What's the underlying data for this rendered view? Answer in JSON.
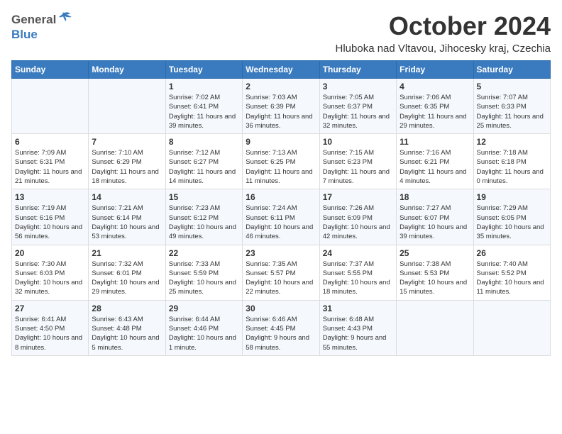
{
  "header": {
    "logo_general": "General",
    "logo_blue": "Blue",
    "month_title": "October 2024",
    "location": "Hluboka nad Vltavou, Jihocesky kraj, Czechia"
  },
  "calendar": {
    "days_of_week": [
      "Sunday",
      "Monday",
      "Tuesday",
      "Wednesday",
      "Thursday",
      "Friday",
      "Saturday"
    ],
    "weeks": [
      [
        {
          "day": "",
          "info": ""
        },
        {
          "day": "",
          "info": ""
        },
        {
          "day": "1",
          "info": "Sunrise: 7:02 AM\nSunset: 6:41 PM\nDaylight: 11 hours and 39 minutes."
        },
        {
          "day": "2",
          "info": "Sunrise: 7:03 AM\nSunset: 6:39 PM\nDaylight: 11 hours and 36 minutes."
        },
        {
          "day": "3",
          "info": "Sunrise: 7:05 AM\nSunset: 6:37 PM\nDaylight: 11 hours and 32 minutes."
        },
        {
          "day": "4",
          "info": "Sunrise: 7:06 AM\nSunset: 6:35 PM\nDaylight: 11 hours and 29 minutes."
        },
        {
          "day": "5",
          "info": "Sunrise: 7:07 AM\nSunset: 6:33 PM\nDaylight: 11 hours and 25 minutes."
        }
      ],
      [
        {
          "day": "6",
          "info": "Sunrise: 7:09 AM\nSunset: 6:31 PM\nDaylight: 11 hours and 21 minutes."
        },
        {
          "day": "7",
          "info": "Sunrise: 7:10 AM\nSunset: 6:29 PM\nDaylight: 11 hours and 18 minutes."
        },
        {
          "day": "8",
          "info": "Sunrise: 7:12 AM\nSunset: 6:27 PM\nDaylight: 11 hours and 14 minutes."
        },
        {
          "day": "9",
          "info": "Sunrise: 7:13 AM\nSunset: 6:25 PM\nDaylight: 11 hours and 11 minutes."
        },
        {
          "day": "10",
          "info": "Sunrise: 7:15 AM\nSunset: 6:23 PM\nDaylight: 11 hours and 7 minutes."
        },
        {
          "day": "11",
          "info": "Sunrise: 7:16 AM\nSunset: 6:21 PM\nDaylight: 11 hours and 4 minutes."
        },
        {
          "day": "12",
          "info": "Sunrise: 7:18 AM\nSunset: 6:18 PM\nDaylight: 11 hours and 0 minutes."
        }
      ],
      [
        {
          "day": "13",
          "info": "Sunrise: 7:19 AM\nSunset: 6:16 PM\nDaylight: 10 hours and 56 minutes."
        },
        {
          "day": "14",
          "info": "Sunrise: 7:21 AM\nSunset: 6:14 PM\nDaylight: 10 hours and 53 minutes."
        },
        {
          "day": "15",
          "info": "Sunrise: 7:23 AM\nSunset: 6:12 PM\nDaylight: 10 hours and 49 minutes."
        },
        {
          "day": "16",
          "info": "Sunrise: 7:24 AM\nSunset: 6:11 PM\nDaylight: 10 hours and 46 minutes."
        },
        {
          "day": "17",
          "info": "Sunrise: 7:26 AM\nSunset: 6:09 PM\nDaylight: 10 hours and 42 minutes."
        },
        {
          "day": "18",
          "info": "Sunrise: 7:27 AM\nSunset: 6:07 PM\nDaylight: 10 hours and 39 minutes."
        },
        {
          "day": "19",
          "info": "Sunrise: 7:29 AM\nSunset: 6:05 PM\nDaylight: 10 hours and 35 minutes."
        }
      ],
      [
        {
          "day": "20",
          "info": "Sunrise: 7:30 AM\nSunset: 6:03 PM\nDaylight: 10 hours and 32 minutes."
        },
        {
          "day": "21",
          "info": "Sunrise: 7:32 AM\nSunset: 6:01 PM\nDaylight: 10 hours and 29 minutes."
        },
        {
          "day": "22",
          "info": "Sunrise: 7:33 AM\nSunset: 5:59 PM\nDaylight: 10 hours and 25 minutes."
        },
        {
          "day": "23",
          "info": "Sunrise: 7:35 AM\nSunset: 5:57 PM\nDaylight: 10 hours and 22 minutes."
        },
        {
          "day": "24",
          "info": "Sunrise: 7:37 AM\nSunset: 5:55 PM\nDaylight: 10 hours and 18 minutes."
        },
        {
          "day": "25",
          "info": "Sunrise: 7:38 AM\nSunset: 5:53 PM\nDaylight: 10 hours and 15 minutes."
        },
        {
          "day": "26",
          "info": "Sunrise: 7:40 AM\nSunset: 5:52 PM\nDaylight: 10 hours and 11 minutes."
        }
      ],
      [
        {
          "day": "27",
          "info": "Sunrise: 6:41 AM\nSunset: 4:50 PM\nDaylight: 10 hours and 8 minutes."
        },
        {
          "day": "28",
          "info": "Sunrise: 6:43 AM\nSunset: 4:48 PM\nDaylight: 10 hours and 5 minutes."
        },
        {
          "day": "29",
          "info": "Sunrise: 6:44 AM\nSunset: 4:46 PM\nDaylight: 10 hours and 1 minute."
        },
        {
          "day": "30",
          "info": "Sunrise: 6:46 AM\nSunset: 4:45 PM\nDaylight: 9 hours and 58 minutes."
        },
        {
          "day": "31",
          "info": "Sunrise: 6:48 AM\nSunset: 4:43 PM\nDaylight: 9 hours and 55 minutes."
        },
        {
          "day": "",
          "info": ""
        },
        {
          "day": "",
          "info": ""
        }
      ]
    ]
  }
}
